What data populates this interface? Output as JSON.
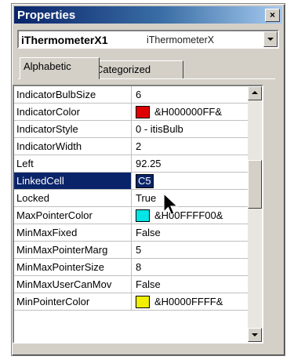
{
  "window": {
    "title": "Properties"
  },
  "object_selector": {
    "name": "iThermometerX1",
    "type": "iThermometerX"
  },
  "tabs": [
    {
      "label": "Alphabetic",
      "active": true
    },
    {
      "label": "Categorized",
      "active": false
    }
  ],
  "properties": [
    {
      "name": "IndicatorBulbSize",
      "value": "6"
    },
    {
      "name": "IndicatorColor",
      "value": "&H000000FF&",
      "swatch": "#e00000"
    },
    {
      "name": "IndicatorStyle",
      "value": "0 - itisBulb"
    },
    {
      "name": "IndicatorWidth",
      "value": "2"
    },
    {
      "name": "Left",
      "value": "92.25"
    },
    {
      "name": "LinkedCell",
      "value": "C5",
      "selected": true
    },
    {
      "name": "Locked",
      "value": "True"
    },
    {
      "name": "MaxPointerColor",
      "value": "&H00FFFF00&",
      "swatch": "#00e5e5"
    },
    {
      "name": "MinMaxFixed",
      "value": "False"
    },
    {
      "name": "MinMaxPointerMarg",
      "value": "5"
    },
    {
      "name": "MinMaxPointerSize",
      "value": "8"
    },
    {
      "name": "MinMaxUserCanMov",
      "value": "False"
    },
    {
      "name": "MinPointerColor",
      "value": "&H0000FFFF&",
      "swatch": "#f0f000"
    }
  ],
  "colors": {
    "selection": "#0a246a",
    "titlebar": "#0a246a",
    "face": "#d4d0c8"
  },
  "icons": {
    "close": "close-icon",
    "dropdown": "chevron-down-icon",
    "cursor": "mouse-pointer-icon"
  }
}
